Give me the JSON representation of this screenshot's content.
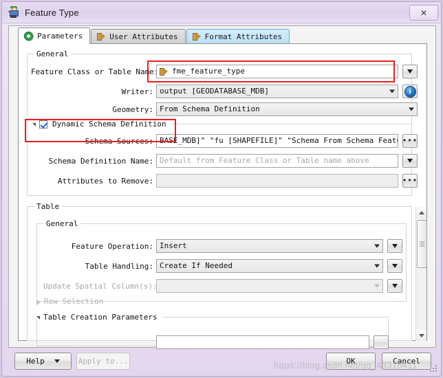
{
  "window": {
    "title": "Feature Type",
    "icon": "fme-workbench-icon",
    "close_label": "✕"
  },
  "tabs": [
    {
      "label": "Parameters",
      "icon": "gear-icon",
      "state": "active"
    },
    {
      "label": "User Attributes",
      "icon": "arrow-icon",
      "state": "normal"
    },
    {
      "label": "Format Attributes",
      "icon": "arrow-icon",
      "state": "hover"
    }
  ],
  "general_group": {
    "title": "General",
    "feature_class": {
      "label": "Feature Class or Table Name:",
      "value": "fme_feature_type",
      "icon": "feature-type-arrow-icon",
      "dropdown_button": "▼"
    },
    "writer": {
      "label": "Writer:",
      "value": "output [GEODATABASE_MDB]",
      "info_button": "i"
    },
    "geometry": {
      "label": "Geometry:",
      "value": "From Schema Definition"
    },
    "dynamic_schema": {
      "label": "Dynamic Schema Definition",
      "checked": true,
      "expanded": true
    },
    "schema_sources": {
      "label": "Schema Sources:",
      "value": "BASE_MDB]\" \"fu [SHAPEFILE]\" \"Schema From Schema Feature\"",
      "browse_button": "•••"
    },
    "schema_definition_name": {
      "label": "Schema Definition Name:",
      "value": "",
      "placeholder": "Default from Feature Class or Table name above",
      "dropdown_button": "▼"
    },
    "attributes_to_remove": {
      "label": "Attributes to Remove:",
      "value": "",
      "browse_button": "•••"
    }
  },
  "table_group": {
    "title": "Table",
    "inner_title": "General",
    "feature_operation": {
      "label": "Feature Operation:",
      "value": "Insert",
      "dropdown_button": "▼"
    },
    "table_handling": {
      "label": "Table Handling:",
      "value": "Create If Needed",
      "dropdown_button": "▼"
    },
    "update_spatial_column": {
      "label": "Update Spatial Column(s):",
      "value": "",
      "disabled": true,
      "dropdown_button": "▼"
    },
    "row_selection": {
      "label": "Row Selection",
      "expanded": false,
      "disabled": true
    },
    "table_creation_parameters": {
      "label": "Table Creation Parameters",
      "expanded": true
    }
  },
  "scrollbar": {
    "up_arrow": "▲",
    "down_arrow": "▼",
    "thumb_position": "top"
  },
  "footer": {
    "help": "Help",
    "help_dropdown": "▼",
    "apply_to": "Apply to...",
    "apply_to_disabled": true,
    "ok": "OK",
    "cancel": "Cancel"
  },
  "watermark": {
    "text": "https://blog.csdn.net/qq_43316411"
  },
  "colors": {
    "titlebar": "#ded2ec",
    "annotation_red": "#ee1c1c",
    "tab_hover_blue": "#b9dff6",
    "accent_orange": "#c08d3e",
    "accent_green": "#35a04a",
    "info_blue": "#1b6fc0"
  }
}
